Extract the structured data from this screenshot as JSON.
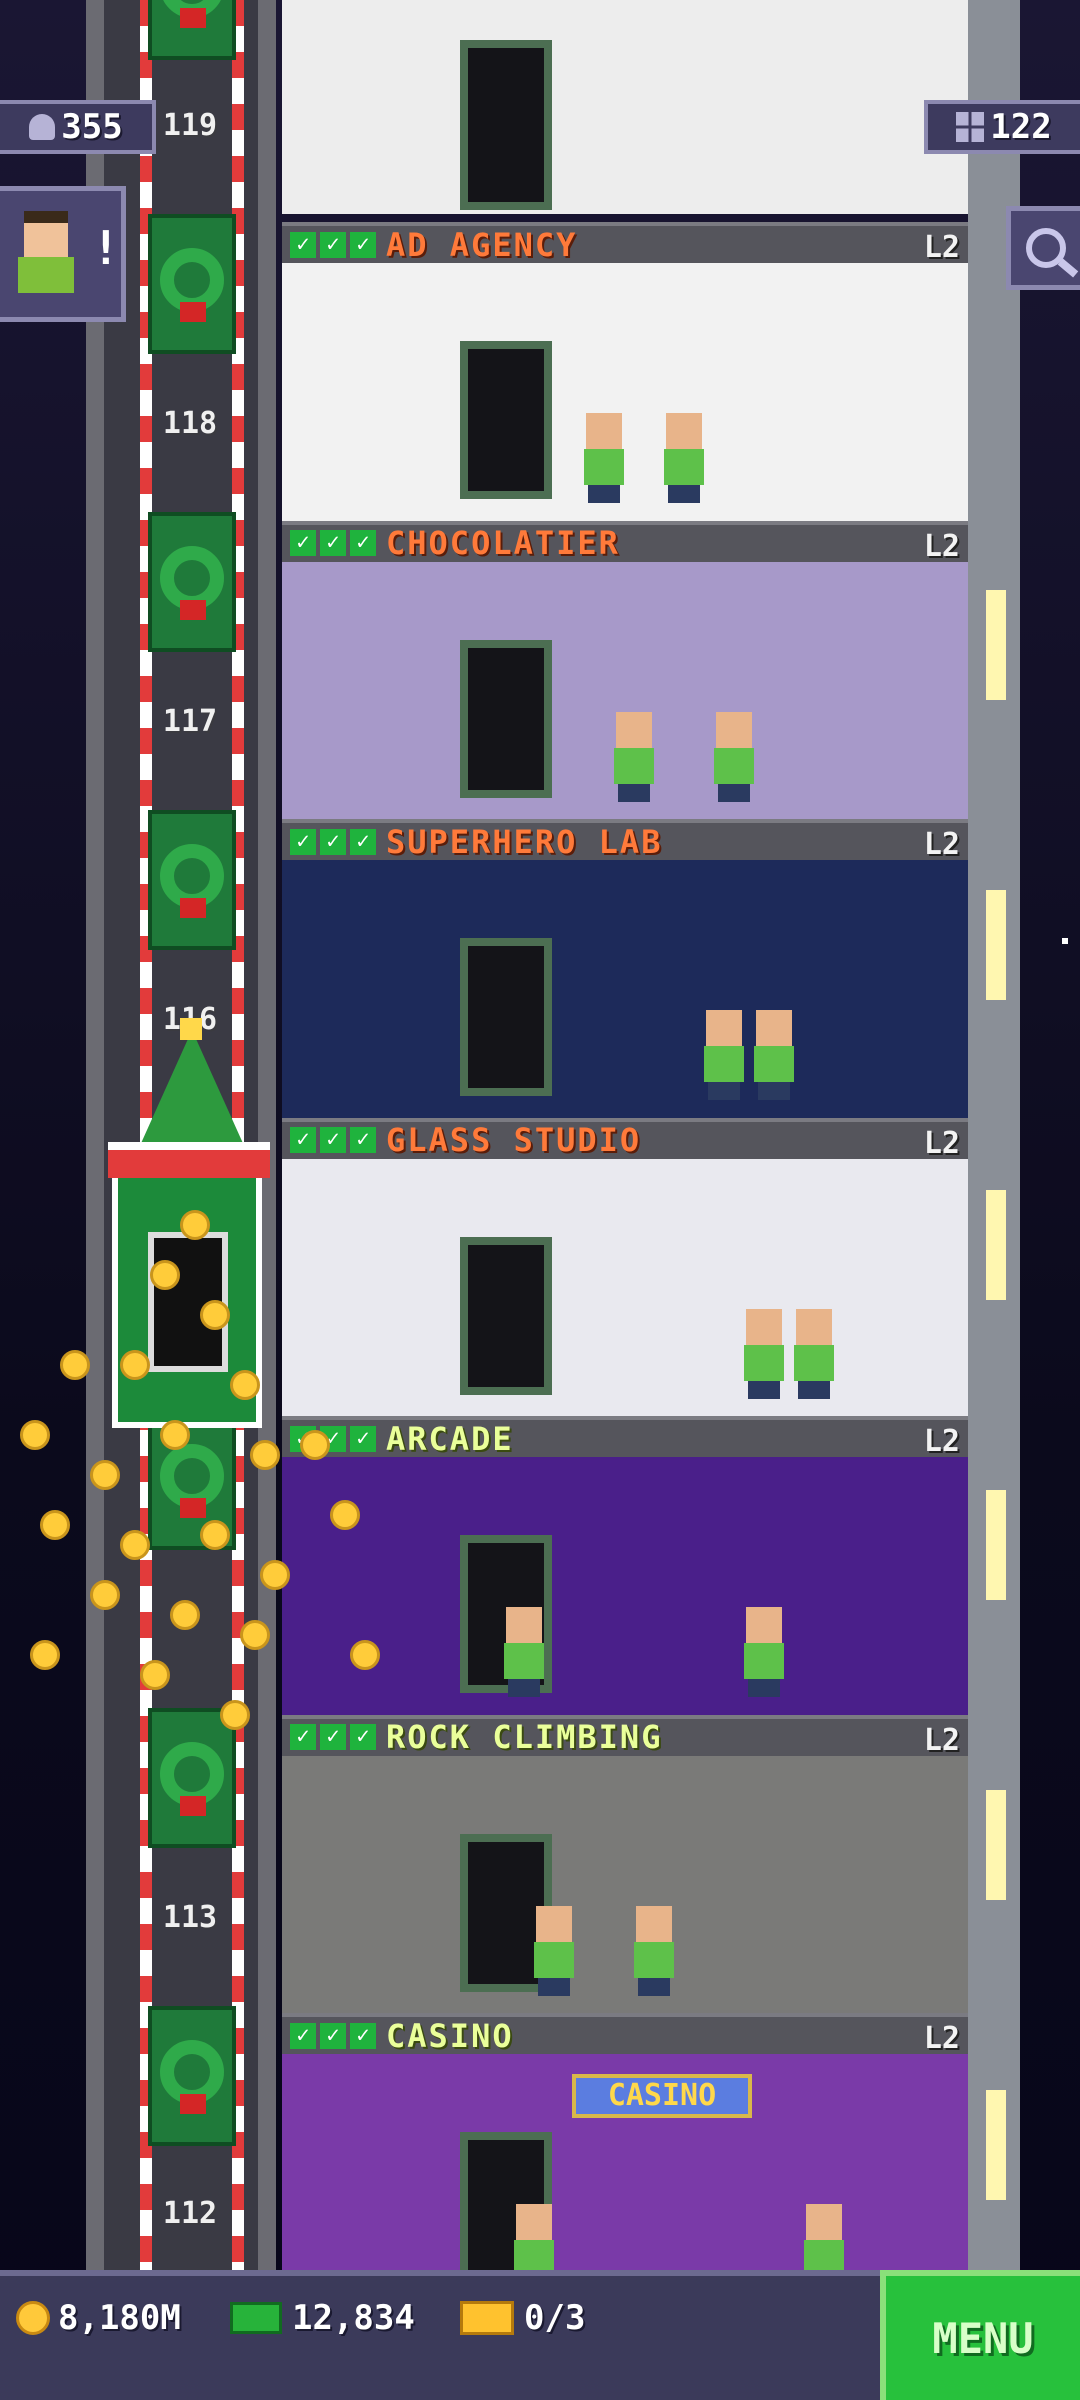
{
  "hud": {
    "population": "355",
    "floors": "122",
    "visitor_alert": "!"
  },
  "shaft": {
    "floor_numbers": [
      "119",
      "118",
      "117",
      "116",
      "113",
      "112"
    ]
  },
  "floors": [
    {
      "name": "AD AGENCY",
      "level": "L2",
      "checks": 3,
      "room_color": "#f2f2f2",
      "name_color": "orange"
    },
    {
      "name": "CHOCOLATIER",
      "level": "L2",
      "checks": 3,
      "room_color": "#a799c9",
      "name_color": "orange"
    },
    {
      "name": "SUPERHERO LAB",
      "level": "L2",
      "checks": 3,
      "room_color": "#1d2a5a",
      "name_color": "orange"
    },
    {
      "name": "GLASS STUDIO",
      "level": "L2",
      "checks": 3,
      "room_color": "#e9e9ef",
      "name_color": "orange"
    },
    {
      "name": "ARCADE",
      "level": "L2",
      "checks": 3,
      "room_color": "#4a1f8a",
      "name_color": "green"
    },
    {
      "name": "ROCK CLIMBING",
      "level": "L2",
      "checks": 3,
      "room_color": "#7a7a78",
      "name_color": "green"
    },
    {
      "name": "CASINO",
      "level": "L2",
      "checks": 3,
      "room_color": "#7a3aa8",
      "name_color": "green"
    }
  ],
  "casino_sign": "CASINO",
  "bottom_bar": {
    "coins": "8,180M",
    "bux": "12,834",
    "tickets": "0/3",
    "menu_label": "MENU"
  },
  "icons": {
    "population": "person-icon",
    "floors": "building-icon",
    "search": "search-icon",
    "coins": "coin-icon",
    "bux": "tower-bux-icon",
    "tickets": "ticket-icon"
  }
}
